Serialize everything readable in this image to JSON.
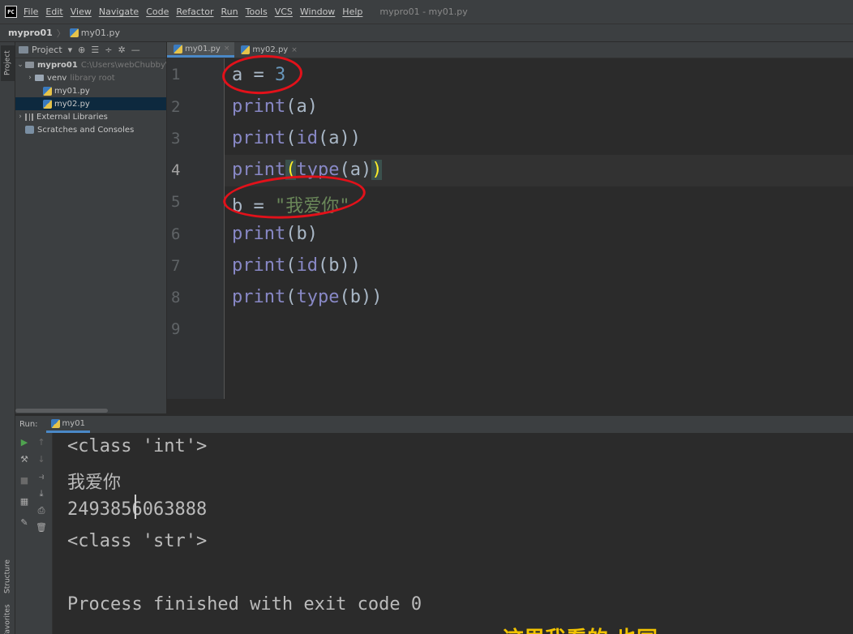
{
  "menubar": {
    "logo": "PC",
    "items": [
      "File",
      "Edit",
      "View",
      "Navigate",
      "Code",
      "Refactor",
      "Run",
      "Tools",
      "VCS",
      "Window",
      "Help"
    ],
    "window_title": "mypro01 - my01.py"
  },
  "breadcrumb": {
    "project": "mypro01",
    "separator": "〉",
    "file": "my01.py"
  },
  "tool_stripe": {
    "project": "Project",
    "structure": "Structure",
    "favorites": "Favorites"
  },
  "project_panel": {
    "view_label": "Project",
    "tree": {
      "root_name": "mypro01",
      "root_path": "C:\\Users\\webChubby\\P",
      "venv_name": "venv",
      "venv_note": "library root",
      "file1": "my01.py",
      "file2": "my02.py",
      "external": "External Libraries",
      "scratches": "Scratches and Consoles"
    }
  },
  "editor": {
    "tabs": [
      {
        "label": "my01.py",
        "active": true
      },
      {
        "label": "my02.py",
        "active": false
      }
    ],
    "line_numbers": [
      "1",
      "2",
      "3",
      "4",
      "5",
      "6",
      "7",
      "8",
      "9"
    ],
    "current_line": 4,
    "lines": {
      "l1_var": "a",
      "l1_op": " = ",
      "l1_num": "3",
      "l2_fn": "print",
      "l2_rest": "(a)",
      "l3_fn": "print",
      "l3_open": "(",
      "l3_inner": "id",
      "l3_rest": "(a))",
      "l4_fn": "print",
      "l4_open": "(",
      "l4_inner": "type",
      "l4_mid": "(a)",
      "l4_close": ")",
      "l5_var": "b",
      "l5_op": " = ",
      "l5_str": "\"我爱你\"",
      "l6_fn": "print",
      "l6_rest": "(b)",
      "l7_fn": "print",
      "l7_open": "(",
      "l7_inner": "id",
      "l7_rest": "(b))",
      "l8_fn": "print",
      "l8_open": "(",
      "l8_inner": "type",
      "l8_rest": "(b))"
    }
  },
  "run_panel": {
    "label": "Run:",
    "tab": "my01",
    "output": [
      "<class 'int'>",
      "我爱你",
      "2493856063888",
      "<class 'str'>",
      "",
      "Process finished with exit code 0"
    ]
  },
  "subtitle_fragment": "这里我看的 也同",
  "colors": {
    "keyword": "#8888c6",
    "number": "#6897bb",
    "string": "#6a8759",
    "annotation": "#e2111a",
    "accent_tab": "#4a88c7"
  }
}
